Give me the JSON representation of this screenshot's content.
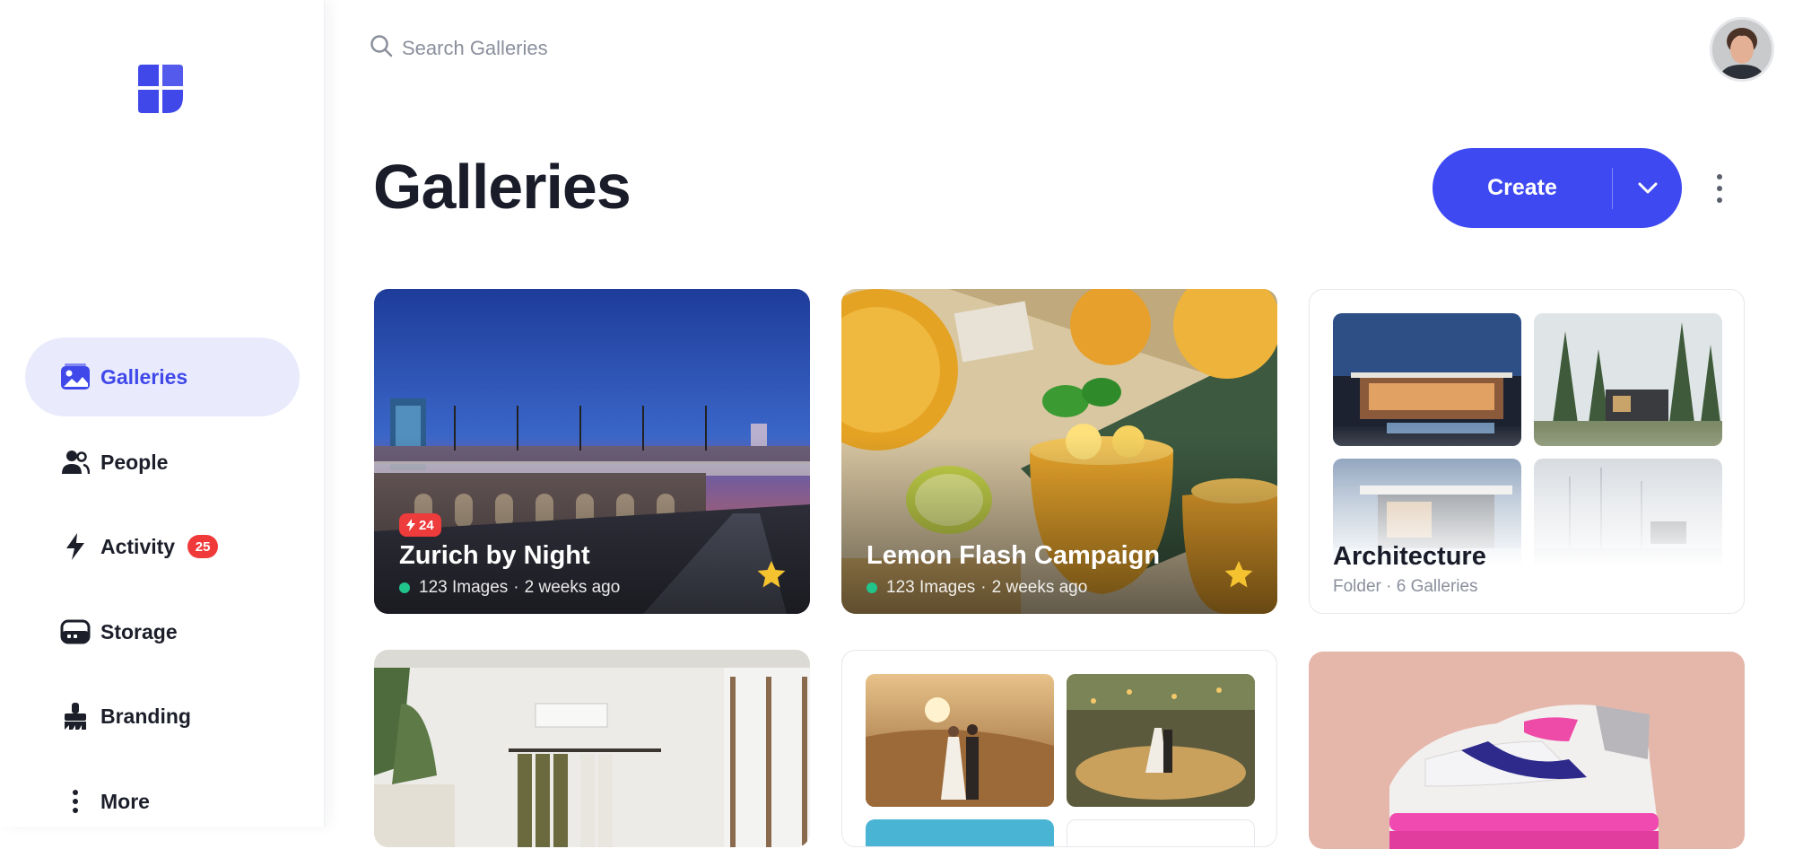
{
  "search": {
    "placeholder": "Search Galleries"
  },
  "page": {
    "title": "Galleries"
  },
  "header": {
    "create_label": "Create"
  },
  "sidebar": {
    "items": [
      {
        "label": "Galleries",
        "icon": "image-icon",
        "active": true
      },
      {
        "label": "People",
        "icon": "people-icon"
      },
      {
        "label": "Activity",
        "icon": "bolt-icon",
        "badge": "25"
      },
      {
        "label": "Storage",
        "icon": "storage-icon"
      },
      {
        "label": "Branding",
        "icon": "brush-icon"
      },
      {
        "label": "More",
        "icon": "more-vertical-icon"
      }
    ]
  },
  "galleries": [
    {
      "title": "Zurich by Night",
      "images": "123 Images",
      "age": "2 weeks ago",
      "flash_count": "24",
      "starred": true
    },
    {
      "title": "Lemon Flash Campaign",
      "images": "123 Images",
      "age": "2 weeks ago",
      "starred": true
    },
    {
      "title": "Architecture",
      "meta": "Folder · 6 Galleries",
      "type": "folder"
    }
  ],
  "colors": {
    "accent": "#3e49f2",
    "badge": "#f03a3a",
    "status": "#21c48b",
    "star": "#f5c330"
  }
}
